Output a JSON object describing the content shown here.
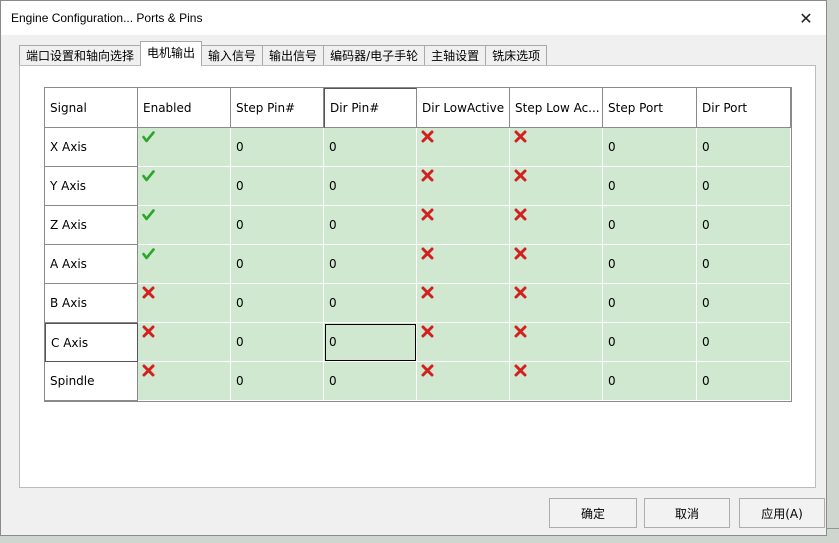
{
  "window": {
    "title": "Engine Configuration... Ports & Pins",
    "close_glyph": "✕"
  },
  "tabs": [
    {
      "label": "端口设置和轴向选择"
    },
    {
      "label": "电机输出"
    },
    {
      "label": "输入信号"
    },
    {
      "label": "输出信号"
    },
    {
      "label": "编码器/电子手轮"
    },
    {
      "label": "主轴设置"
    },
    {
      "label": "铣床选项"
    }
  ],
  "active_tab": 1,
  "grid": {
    "columns": [
      "Signal",
      "Enabled",
      "Step Pin#",
      "Dir Pin#",
      "Dir LowActive",
      "Step Low Ac...",
      "Step Port",
      "Dir Port"
    ],
    "rows": [
      {
        "signal": "X Axis",
        "enabled": true,
        "step_pin": "0",
        "dir_pin": "0",
        "dir_low_active": false,
        "step_low_active": false,
        "step_port": "0",
        "dir_port": "0"
      },
      {
        "signal": "Y Axis",
        "enabled": true,
        "step_pin": "0",
        "dir_pin": "0",
        "dir_low_active": false,
        "step_low_active": false,
        "step_port": "0",
        "dir_port": "0"
      },
      {
        "signal": "Z Axis",
        "enabled": true,
        "step_pin": "0",
        "dir_pin": "0",
        "dir_low_active": false,
        "step_low_active": false,
        "step_port": "0",
        "dir_port": "0"
      },
      {
        "signal": "A Axis",
        "enabled": true,
        "step_pin": "0",
        "dir_pin": "0",
        "dir_low_active": false,
        "step_low_active": false,
        "step_port": "0",
        "dir_port": "0"
      },
      {
        "signal": "B Axis",
        "enabled": false,
        "step_pin": "0",
        "dir_pin": "0",
        "dir_low_active": false,
        "step_low_active": false,
        "step_port": "0",
        "dir_port": "0"
      },
      {
        "signal": "C Axis",
        "enabled": false,
        "step_pin": "0",
        "dir_pin": "0",
        "dir_low_active": false,
        "step_low_active": false,
        "step_port": "0",
        "dir_port": "0"
      },
      {
        "signal": "Spindle",
        "enabled": false,
        "step_pin": "0",
        "dir_pin": "0",
        "dir_low_active": false,
        "step_low_active": false,
        "step_port": "0",
        "dir_port": "0"
      }
    ],
    "current_row": 5,
    "current_col": 3,
    "check_icon": "green-check-icon",
    "cross_icon": "red-cross-icon",
    "check_color": "#2ca52c",
    "cross_color": "#d41f1f",
    "cell_bg": "#cfe8cf"
  },
  "buttons": {
    "ok": "确定",
    "cancel": "取消",
    "apply": "应用(A)"
  }
}
